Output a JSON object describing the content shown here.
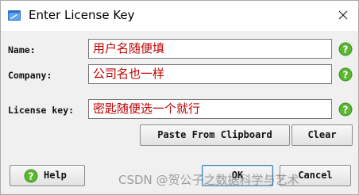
{
  "window": {
    "title": "Enter License Key",
    "close_icon": "close-icon",
    "app_icon": "key-window-icon"
  },
  "fields": {
    "name": {
      "label": "Name:",
      "value": "用户名随便填"
    },
    "company": {
      "label": "Company:",
      "value": "公司名也一样"
    },
    "license_key": {
      "label": "License key:",
      "value": "密匙随便选一个就行"
    }
  },
  "buttons": {
    "paste": "Paste From Clipboard",
    "clear": "Clear",
    "help": "Help",
    "ok": "OK",
    "cancel": "Cancel"
  },
  "watermark": "CSDN @贺公子之数据科学与艺术",
  "colors": {
    "help_icon": "#3f9a1f",
    "input_text": "#c00000",
    "default_button_border": "#3c7fb1"
  }
}
